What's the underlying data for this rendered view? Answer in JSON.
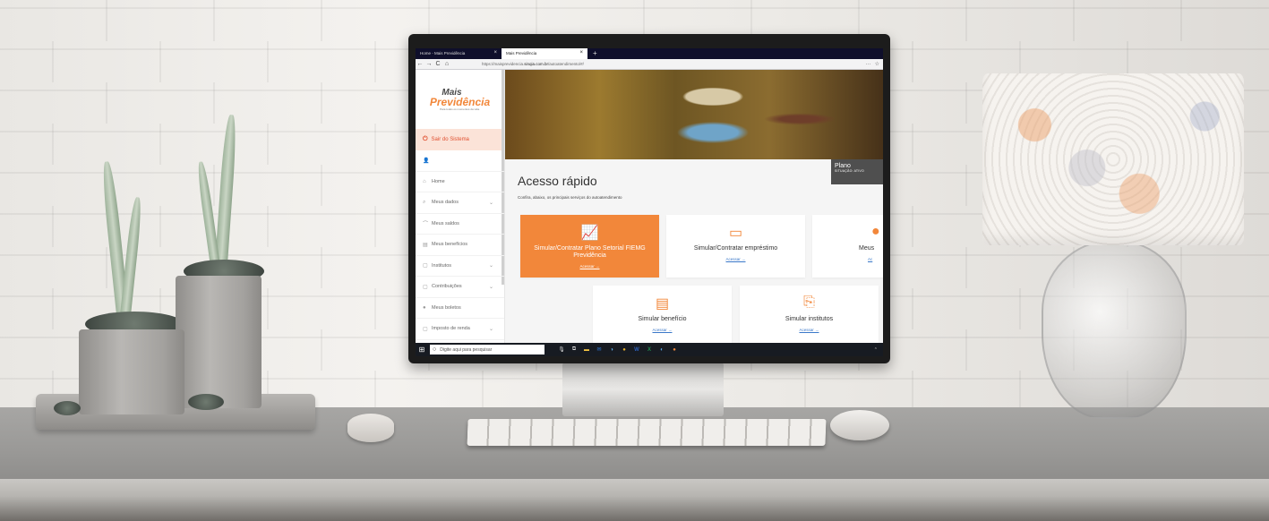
{
  "browser": {
    "tabs": [
      {
        "label": "Home - Mais Previdência",
        "active": false
      },
      {
        "label": "Mais Previdência",
        "active": true
      }
    ],
    "new_tab": "+",
    "close": "×",
    "url_prefix": "https://maisprevidencia.",
    "url_domain": "sinqia.com.br",
    "url_suffix": "/autoatendimento/#/",
    "icons": {
      "back": "←",
      "forward": "→",
      "reload": "C",
      "home": "⌂",
      "shield": "◍",
      "lock": "🔒",
      "more": "···",
      "pocket": "☉",
      "star": "☆"
    }
  },
  "sidebar": {
    "logo_top": "Mais",
    "logo_main": "Previdência",
    "logo_tagline": "Para todos os momentos da vida.",
    "logout_label": "Sair do Sistema",
    "items": [
      {
        "label": "",
        "icon": "👤",
        "chevron": false
      },
      {
        "label": "Home",
        "icon": "⌂",
        "chevron": false
      },
      {
        "label": "Meus dados",
        "icon": "⌕",
        "chevron": true
      },
      {
        "label": "Meus saldos",
        "icon": "⌒",
        "chevron": false
      },
      {
        "label": "Meus benefícios",
        "icon": "▤",
        "chevron": false
      },
      {
        "label": "Institutos",
        "icon": "▢",
        "chevron": true
      },
      {
        "label": "Contribuições",
        "icon": "▢",
        "chevron": true
      },
      {
        "label": "Meus boletos",
        "icon": "●",
        "chevron": false
      },
      {
        "label": "Imposto de renda",
        "icon": "▢",
        "chevron": true
      }
    ],
    "chevron": "⌄"
  },
  "main": {
    "plano_title": "Plano",
    "plano_status": "SITUAÇÃO: ATIVO",
    "heading": "Acesso rápido",
    "subheading": "Confira, abaixo, os principais serviços do autoatendimento",
    "cards": [
      {
        "title": "Simular/Contratar Plano Setorial FIEMG Previdência",
        "link": "Acessar →",
        "icon": "📈"
      },
      {
        "title": "Simular/Contratar empréstimo",
        "link": "Acessar →",
        "icon": "▭"
      },
      {
        "title": "Meus",
        "link": "Ac",
        "icon": "●"
      },
      {
        "title": "Simular benefício",
        "link": "Acessar →",
        "icon": "▤"
      },
      {
        "title": "Simular institutos",
        "link": "Acessar →",
        "icon": "⎘"
      }
    ]
  },
  "taskbar": {
    "start": "⊞",
    "search_placeholder": "Digite aqui para pesquisar",
    "search_icon": "○",
    "apps": [
      "🎙",
      "⧉",
      "▬",
      "✉",
      "◑",
      "●",
      "W",
      "X",
      "◐",
      "●"
    ],
    "corner": "⌃"
  },
  "colors": {
    "brand_orange": "#f2873a",
    "link_blue": "#3a78c9",
    "logout_bg": "#fbe3d8",
    "taskbar": "#171b22"
  }
}
